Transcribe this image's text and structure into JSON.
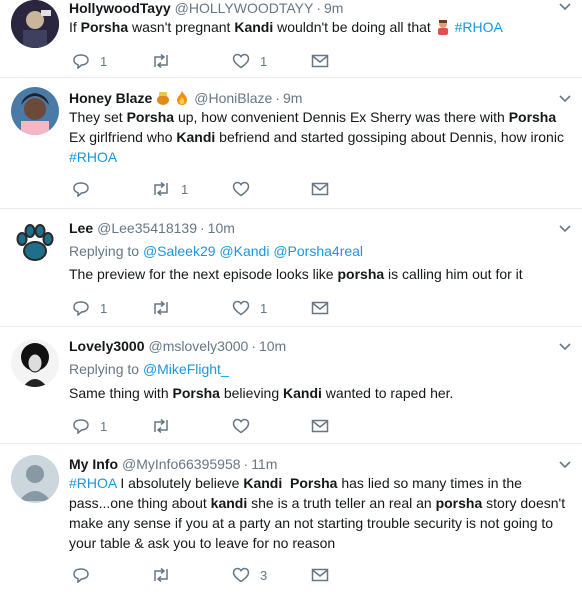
{
  "tweets": [
    {
      "name": "HollywoodTayy",
      "handle": "@HOLLYWOODTAYY",
      "time": "9m",
      "text": [
        "If ",
        "Porsha",
        " wasn't pregnant ",
        "Kandi",
        " wouldn't be doing all that ",
        "#RHOA"
      ],
      "replies": "1",
      "retweets": "",
      "likes": "1"
    },
    {
      "name": "Honey Blaze",
      "handle": "@HoniBlaze",
      "time": "9m",
      "text": [
        "They set ",
        "Porsha",
        " up, how convenient Dennis Ex Sherry was there with ",
        "Porsha",
        " Ex girlfriend who ",
        "Kandi",
        " befriend and started gossiping about Dennis, how ironic ",
        "#RHOA"
      ],
      "replies": "",
      "retweets": "1",
      "likes": ""
    },
    {
      "name": "Lee",
      "handle": "@Lee35418139",
      "time": "10m",
      "reply_prefix": "Replying to",
      "reply_to": [
        "@Saleek29",
        "@Kandi",
        "@Porsha4real"
      ],
      "text": [
        "The preview for the next episode looks like ",
        "porsha",
        " is calling him out for it"
      ],
      "replies": "1",
      "retweets": "",
      "likes": "1"
    },
    {
      "name": "Lovely3000",
      "handle": "@mslovely3000",
      "time": "10m",
      "reply_prefix": "Replying to",
      "reply_to": [
        "@MikeFlight_"
      ],
      "text": [
        "Same thing with ",
        "Porsha",
        " believing ",
        "Kandi",
        " wanted to raped her."
      ],
      "replies": "1",
      "retweets": "",
      "likes": ""
    },
    {
      "name": "My Info",
      "handle": "@MyInfo66395958",
      "time": "11m",
      "text": [
        "#RHOA",
        " I absolutely believe ",
        "Kandi",
        "  ",
        "Porsha",
        " has lied so many times in the pass...one thing about ",
        "kandi",
        " she is a truth teller an real an ",
        "porsha",
        " story doesn't make any sense if you at a party an not starting trouble security is not going to your table & ask you to leave for no reason"
      ],
      "replies": "",
      "retweets": "",
      "likes": "3"
    }
  ],
  "dot": "·",
  "colors": {
    "link": "#1b95e0",
    "muted": "#657786",
    "border": "#e6ecf0"
  }
}
